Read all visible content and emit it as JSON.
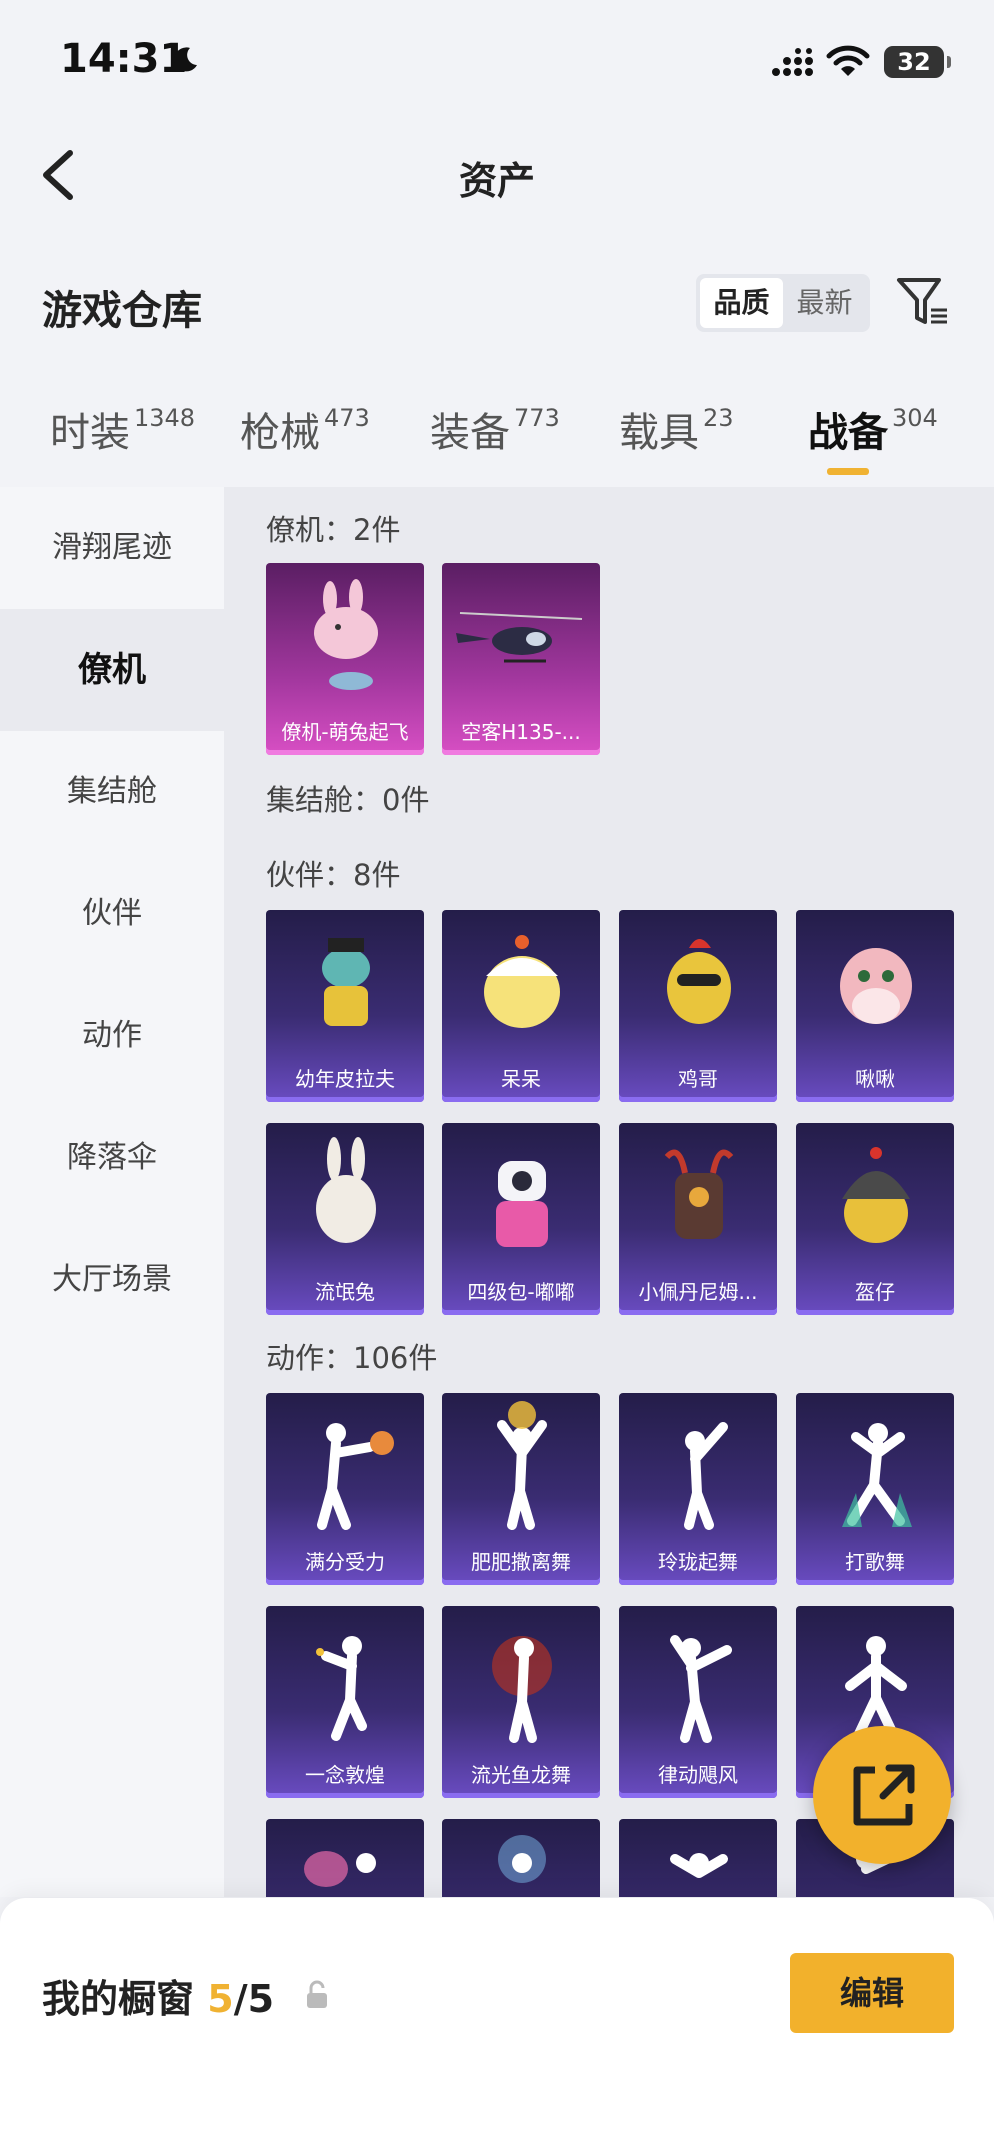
{
  "status_bar": {
    "time": "14:31",
    "battery": "32"
  },
  "nav": {
    "title": "资产"
  },
  "header": {
    "title": "游戏仓库",
    "sort_options": [
      "品质",
      "最新"
    ]
  },
  "tabs": [
    {
      "label": "时装",
      "count": "1348"
    },
    {
      "label": "枪械",
      "count": "473"
    },
    {
      "label": "装备",
      "count": "773"
    },
    {
      "label": "载具",
      "count": "23"
    },
    {
      "label": "战备",
      "count": "304"
    }
  ],
  "sidebar": {
    "items": [
      "滑翔尾迹",
      "僚机",
      "集结舱",
      "伙伴",
      "动作",
      "降落伞",
      "大厅场景"
    ]
  },
  "groups": {
    "wingman": {
      "title": "僚机：2件",
      "items": [
        "僚机-萌兔起飞",
        "空客H135-..."
      ]
    },
    "capsule": {
      "title": "集结舱：0件"
    },
    "partner": {
      "title": "伙伴：8件",
      "items": [
        "幼年皮拉夫",
        "呆呆",
        "鸡哥",
        "啾啾",
        "流氓兔",
        "四级包-嘟嘟",
        "小佩丹尼姆...",
        "盔仔"
      ]
    },
    "action": {
      "title": "动作：106件",
      "items": [
        "满分受力",
        "肥肥撒离舞",
        "玲珑起舞",
        "打歌舞",
        "一念敦煌",
        "流光鱼龙舞",
        "律动飓风",
        ""
      ]
    }
  },
  "bottom": {
    "my_window_label": "我的橱窗",
    "count_current": "5",
    "count_sep_total": "/5",
    "edit_label": "编辑"
  },
  "colors": {
    "accent": "#f2b12c",
    "card_purple": "#3a2c72",
    "card_pink": "#a2379e"
  },
  "icons": [
    "back-icon",
    "filter-icon",
    "share-icon",
    "lock-icon",
    "moon-icon",
    "signal-icon",
    "wifi-icon"
  ]
}
